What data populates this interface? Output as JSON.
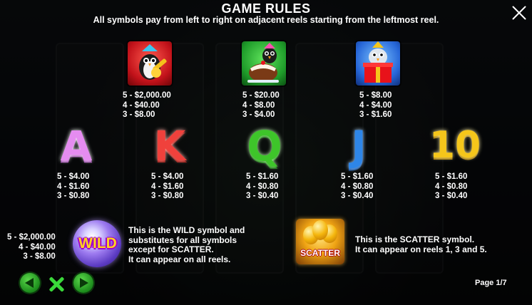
{
  "header": {
    "title": "GAME RULES",
    "subtitle": "All symbols pay from left to right on adjacent reels starting from the leftmost reel."
  },
  "high_symbols": [
    {
      "name": "penguin-guitar",
      "pays": "5 - $2,000.00\n4 - $40.00\n3 - $8.00"
    },
    {
      "name": "penguin-cake",
      "pays": "5 - $20.00\n4 - $8.00\n3 - $4.00"
    },
    {
      "name": "penguin-gift",
      "pays": "5 - $8.00\n4 - $4.00\n3 - $1.60"
    }
  ],
  "low_symbols": [
    {
      "glyph": "A",
      "color": "#e58cf0",
      "pays": "5 - $4.00\n4 - $1.60\n3 - $0.80"
    },
    {
      "glyph": "K",
      "color": "#f0413c",
      "pays": "5 - $4.00\n4 - $1.60\n3 - $0.80"
    },
    {
      "glyph": "Q",
      "color": "#3ec52a",
      "pays": "5 - $1.60\n4 - $0.80\n3 - $0.40"
    },
    {
      "glyph": "J",
      "color": "#2e86e8",
      "pays": "5 - $1.60\n4 - $0.80\n3 - $0.40"
    },
    {
      "glyph": "10",
      "color": "#f5c61b",
      "pays": "5 - $1.60\n4 - $0.80\n3 - $0.40"
    }
  ],
  "wild": {
    "label": "WILD",
    "pays": "5 - $2,000.00\n4 - $40.00\n3 - $8.00",
    "description": "This is the WILD symbol and\nsubstitutes for all symbols\nexcept for SCATTER.\nIt can appear on all reels."
  },
  "scatter": {
    "label": "SCATTER",
    "description": "This is the SCATTER symbol.\nIt can appear on reels 1, 3 and 5."
  },
  "footer": {
    "page": "Page 1/7"
  },
  "colors": {
    "nav_green": "#1b8a1b",
    "close_x": "#3ad83a"
  },
  "icons": [
    "close-icon",
    "arrow-left-icon",
    "arrow-right-icon",
    "x-icon"
  ]
}
